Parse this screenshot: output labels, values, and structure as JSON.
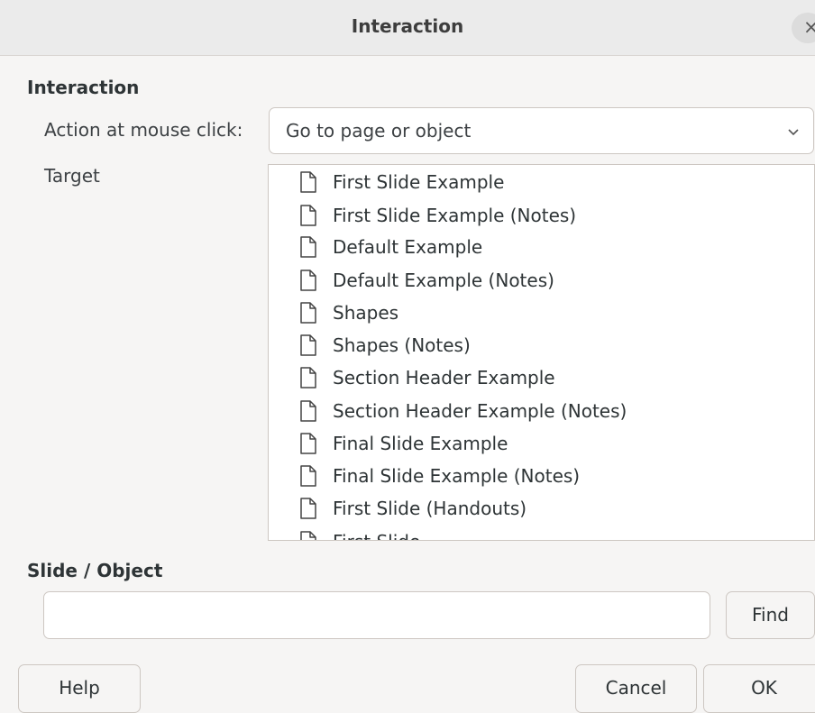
{
  "dialog": {
    "title": "Interaction",
    "close_icon": "close-icon"
  },
  "interaction": {
    "section_title": "Interaction",
    "action_label": "Action at mouse click:",
    "action_value": "Go to page or object",
    "target_label": "Target",
    "target_items": [
      {
        "label": "First Slide Example",
        "icon": "document-icon"
      },
      {
        "label": "First Slide Example (Notes)",
        "icon": "document-icon"
      },
      {
        "label": "Default Example",
        "icon": "document-icon"
      },
      {
        "label": "Default Example (Notes)",
        "icon": "document-icon"
      },
      {
        "label": "Shapes",
        "icon": "document-icon"
      },
      {
        "label": "Shapes (Notes)",
        "icon": "document-icon"
      },
      {
        "label": "Section Header Example",
        "icon": "document-icon"
      },
      {
        "label": "Section Header Example (Notes)",
        "icon": "document-icon"
      },
      {
        "label": "Final Slide Example",
        "icon": "document-icon"
      },
      {
        "label": "Final Slide Example (Notes)",
        "icon": "document-icon"
      },
      {
        "label": "First Slide (Handouts)",
        "icon": "document-icon"
      },
      {
        "label": "First Slide",
        "icon": "document-icon"
      }
    ]
  },
  "slide_object": {
    "section_title": "Slide / Object",
    "input_value": "",
    "find_label": "Find"
  },
  "buttons": {
    "help": "Help",
    "cancel": "Cancel",
    "ok": "OK"
  },
  "colors": {
    "background": "#f6f5f4",
    "titlebar": "#ebebeb",
    "border": "#cdc7c2"
  }
}
